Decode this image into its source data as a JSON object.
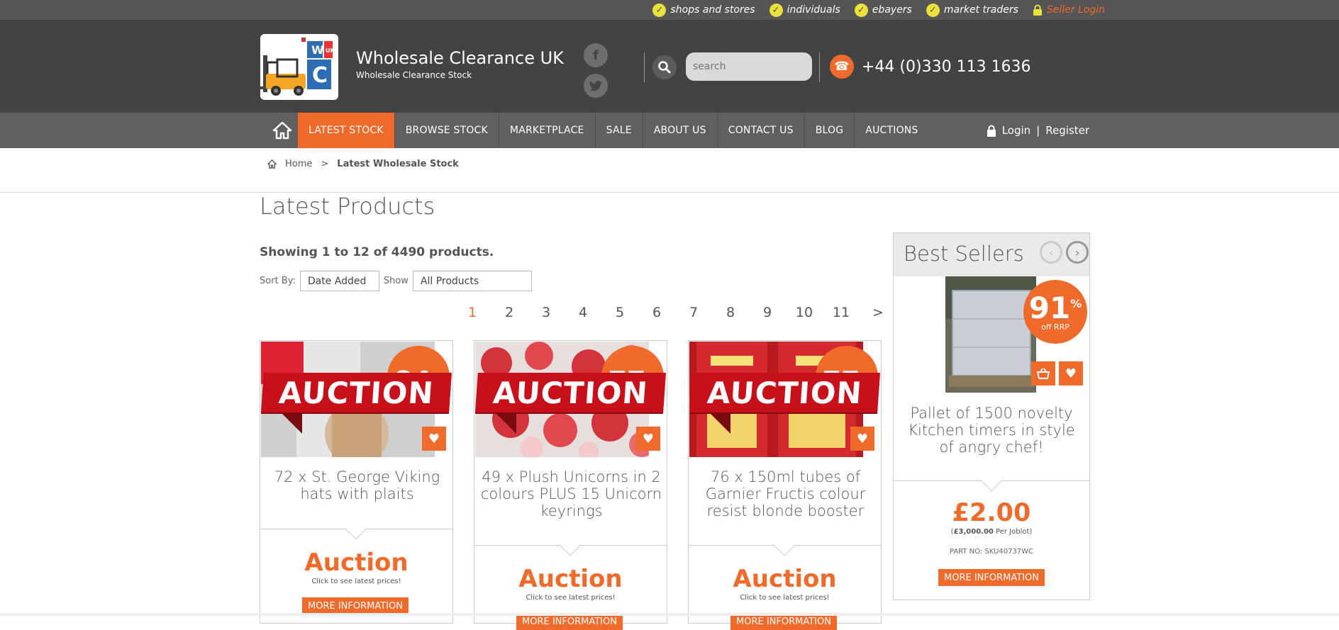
{
  "topbar": {
    "links": [
      {
        "label": "shops and stores"
      },
      {
        "label": "individuals"
      },
      {
        "label": "ebayers"
      },
      {
        "label": "market traders"
      }
    ],
    "seller_login": "Seller Login"
  },
  "header": {
    "title": "Wholesale Clearance UK",
    "subtitle": "Wholesale Clearance Stock",
    "search_placeholder": "search",
    "phone": "+44 (0)330 113 1636",
    "logo_letters": [
      "W",
      "C",
      "UK"
    ]
  },
  "nav": {
    "items": [
      {
        "label": "LATEST STOCK",
        "active": true
      },
      {
        "label": "BROWSE STOCK"
      },
      {
        "label": "MARKETPLACE"
      },
      {
        "label": "SALE"
      },
      {
        "label": "ABOUT US"
      },
      {
        "label": "CONTACT US"
      },
      {
        "label": "BLOG"
      },
      {
        "label": "AUCTIONS"
      }
    ],
    "login": "Login",
    "separator": "|",
    "register": "Register"
  },
  "breadcrumb": {
    "home": "Home",
    "sep": ">",
    "current": "Latest Wholesale Stock"
  },
  "main": {
    "title": "Latest Products",
    "showing": "Showing 1 to 12 of 4490 products.",
    "sort_label": "Sort By:",
    "sort_value": "Date Added",
    "show_label": "Show",
    "show_value": "All Products"
  },
  "pagination": {
    "pages": [
      "1",
      "2",
      "3",
      "4",
      "5",
      "6",
      "7",
      "8",
      "9",
      "10",
      "11"
    ],
    "current": "1",
    "next": ">"
  },
  "products": [
    {
      "title": "72 x St. George Viking hats with plaits",
      "discount": "84",
      "banner": "AUCTION",
      "price_label": "Auction",
      "price_note": "Click to see latest prices!",
      "button": "MORE INFORMATION"
    },
    {
      "title": "49 x Plush Unicorns in 2 colours PLUS 15 Unicorn keyrings",
      "discount": "77",
      "banner": "AUCTION",
      "price_label": "Auction",
      "price_note": "Click to see latest prices!",
      "button": "MORE INFORMATION"
    },
    {
      "title": "76 x 150ml tubes of Garnier Fructis colour resist blonde booster",
      "discount": "77",
      "banner": "AUCTION",
      "price_label": "Auction",
      "price_note": "Click to see latest prices!",
      "button": "MORE INFORMATION"
    }
  ],
  "best_sellers": {
    "title": "Best Sellers",
    "discount": "91",
    "pct_sign": "%",
    "off_label": "off RRP",
    "name": "Pallet of 1500 novelty Kitchen timers in style of angry chef!",
    "price": "£2.00",
    "per_joblot_open": "(",
    "per_joblot_value": "£3,000.00",
    "per_joblot_text": " Per Joblot)",
    "part_no": "PART NO: SKU40737WC",
    "button": "MORE INFORMATION"
  },
  "colors": {
    "accent": "#f06a2b",
    "header_bg": "#434343",
    "nav_bg": "#606060",
    "topbar_bg": "#555555",
    "auction_red": "#c8101b"
  },
  "icons": [
    "check-icon",
    "lock-icon",
    "facebook-icon",
    "twitter-icon",
    "search-icon",
    "phone-icon",
    "home-icon",
    "heart-icon",
    "basket-icon",
    "chevron-left-icon",
    "chevron-right-icon"
  ]
}
